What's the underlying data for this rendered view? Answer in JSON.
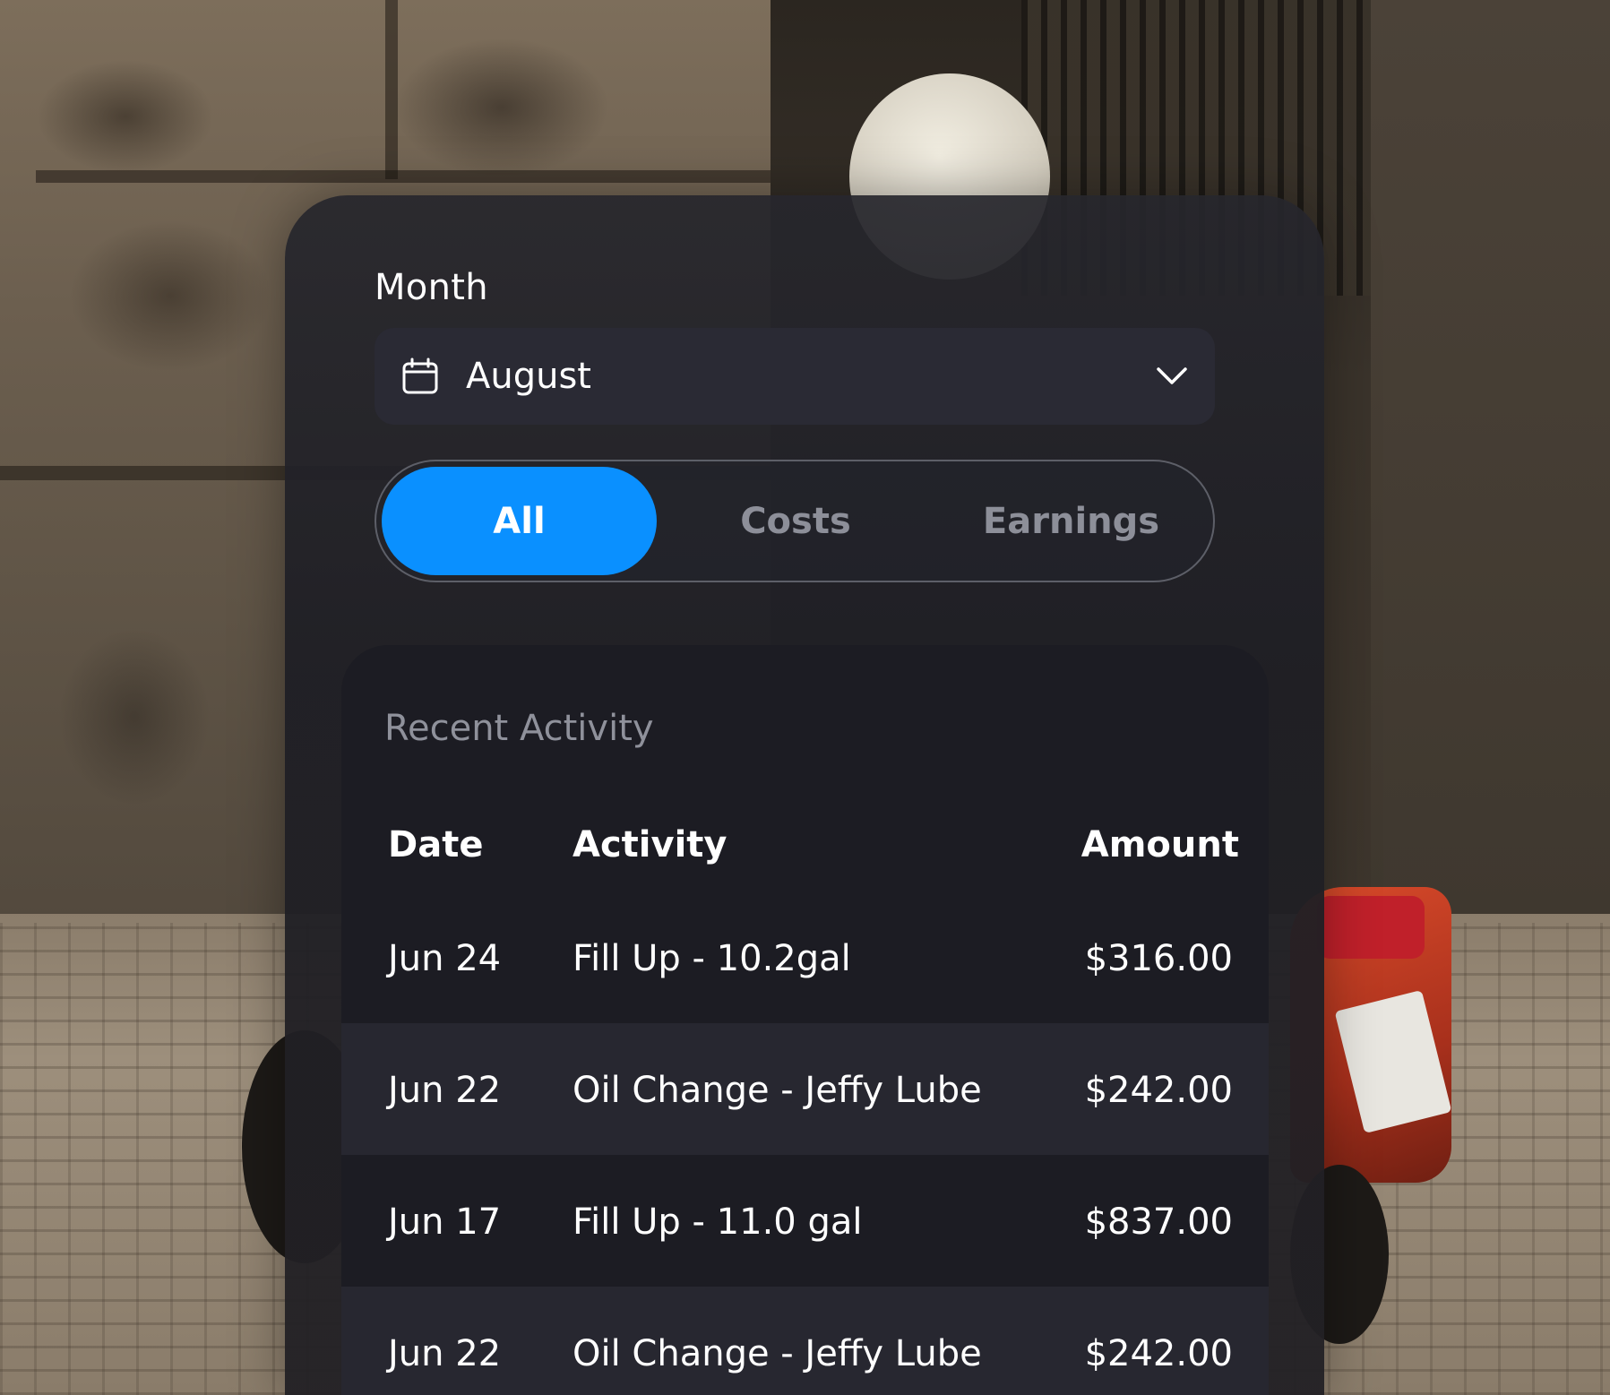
{
  "month_filter": {
    "label": "Month",
    "selected": "August",
    "icon": "calendar-icon",
    "dropdown_icon": "chevron-down-icon"
  },
  "segments": {
    "items": [
      "All",
      "Costs",
      "Earnings"
    ],
    "active": "All",
    "active_color": "#0a90ff"
  },
  "recent_activity": {
    "title": "Recent Activity",
    "columns": [
      "Date",
      "Activity",
      "Amount"
    ],
    "rows": [
      {
        "date": "Jun 24",
        "activity": "Fill Up - 10.2gal",
        "amount": "$316.00"
      },
      {
        "date": "Jun 22",
        "activity": "Oil Change - Jeffy Lube",
        "amount": "$242.00"
      },
      {
        "date": "Jun 17",
        "activity": "Fill Up - 11.0 gal",
        "amount": "$837.00"
      },
      {
        "date": "Jun 22",
        "activity": "Oil Change - Jeffy Lube",
        "amount": "$242.00"
      }
    ]
  }
}
